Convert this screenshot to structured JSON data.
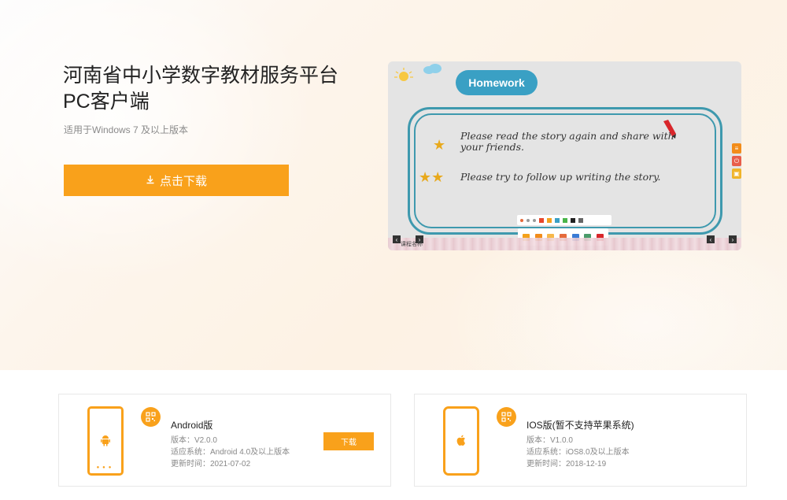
{
  "hero": {
    "title_line1": "河南省中小学数字教材服务平台",
    "title_line2": "PC客户端",
    "subtitle": "适用于Windows 7 及以上版本",
    "download_label": "点击下载"
  },
  "preview": {
    "homework_label": "Homework",
    "line1": "Please read the story again and share with your friends.",
    "line2": "Please try to follow up writing the story.",
    "line1_stars": "★",
    "line2_stars": "★★",
    "footer_label": "课程名称"
  },
  "cards": [
    {
      "name": "Android版",
      "version": "版本：V2.0.0",
      "system": "适应系统：Android 4.0及以上版本",
      "updated": "更新时间：2021-07-02",
      "button_label": "下载",
      "icon": "android-icon"
    },
    {
      "name": "IOS版(暂不支持苹果系统)",
      "version": "版本：V1.0.0",
      "system": "适应系统：iOS8.0及以上版本",
      "updated": "更新时间：2018-12-19",
      "icon": "apple-icon"
    }
  ],
  "colors": {
    "accent": "#f9a11b",
    "teal": "#3aa0c4",
    "board_border": "#3e99ae"
  }
}
